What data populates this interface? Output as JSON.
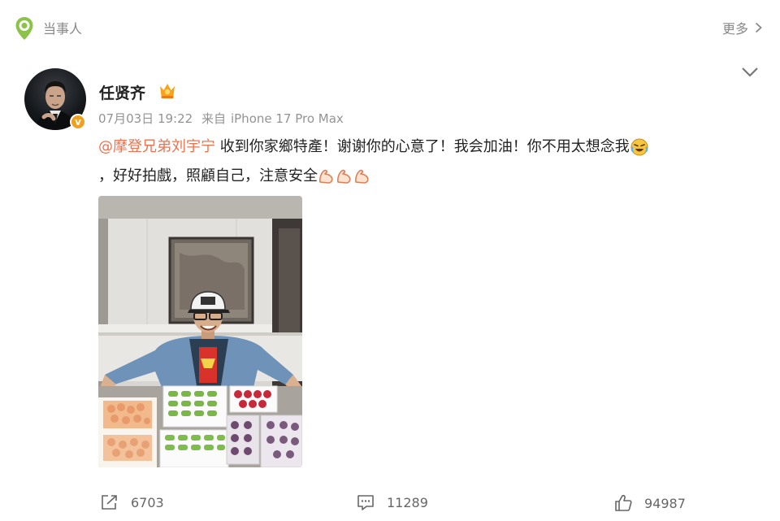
{
  "header": {
    "topic_label": "当事人",
    "more_label": "更多"
  },
  "post": {
    "author": "任贤齐",
    "verified_mark": "v",
    "timestamp": "07月03日 19:22",
    "source_prefix": "来自",
    "device": "iPhone 17 Pro Max",
    "mention": "@摩登兄弟刘宇宁",
    "text_part1": " 收到你家鄉特產！谢谢你的心意了！我会加油！你不用太想念我",
    "text_part2": "，好好拍戲，照顧自己，注意安全",
    "emojis": [
      "cry-laugh-emoji",
      "strong-arm-emoji",
      "strong-arm-emoji",
      "strong-arm-emoji"
    ]
  },
  "actions": {
    "share_count": "6703",
    "comment_count": "11289",
    "like_count": "94987"
  },
  "colors": {
    "mention": "#eb7350",
    "location_icon": "#8bc34a",
    "badge": "#f0a020"
  }
}
